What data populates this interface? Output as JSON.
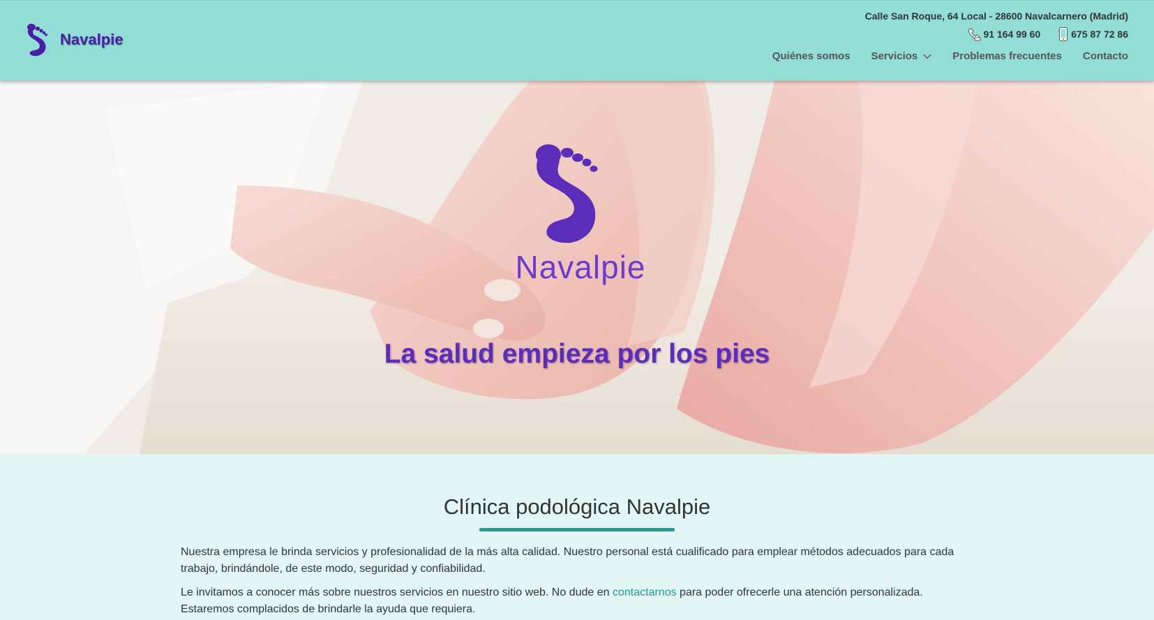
{
  "header": {
    "brand_name": "Navalpie",
    "address": "Calle San Roque, 64 Local - 28600 Navalcarnero (Madrid)",
    "phones": [
      {
        "icon": "landline-phone-icon",
        "number": "91 164 99 60"
      },
      {
        "icon": "mobile-phone-icon",
        "number": "675 87 72 86"
      }
    ],
    "nav": [
      {
        "label": "Quiénes somos"
      },
      {
        "label": "Servicios",
        "has_dropdown": true
      },
      {
        "label": "Problemas frecuentes"
      },
      {
        "label": "Contacto"
      }
    ]
  },
  "hero": {
    "logo_text": "Navalpie",
    "title": "La salud empieza por los pies"
  },
  "main": {
    "title": "Clínica podológica Navalpie",
    "paragraph1": "Nuestra empresa le brinda servicios y profesionalidad de la más alta calidad. Nuestro personal está cualificado para emplear métodos adecuados para cada trabajo, brindándole, de este modo, seguridad y confiabilidad.",
    "paragraph2_before": "Le invitamos a conocer más sobre nuestros servicios en nuestro sitio web. No dude en ",
    "paragraph2_link": "contactarnos",
    "paragraph2_after": " para poder ofrecerle una atención personalizada. Estaremos complacidos de brindarle la ayuda que requiera."
  },
  "colors": {
    "header_bg": "#92ddd6",
    "brand_purple": "#4a1ea8",
    "accent_teal": "#1d9d95",
    "content_bg": "#e2f6f3"
  }
}
